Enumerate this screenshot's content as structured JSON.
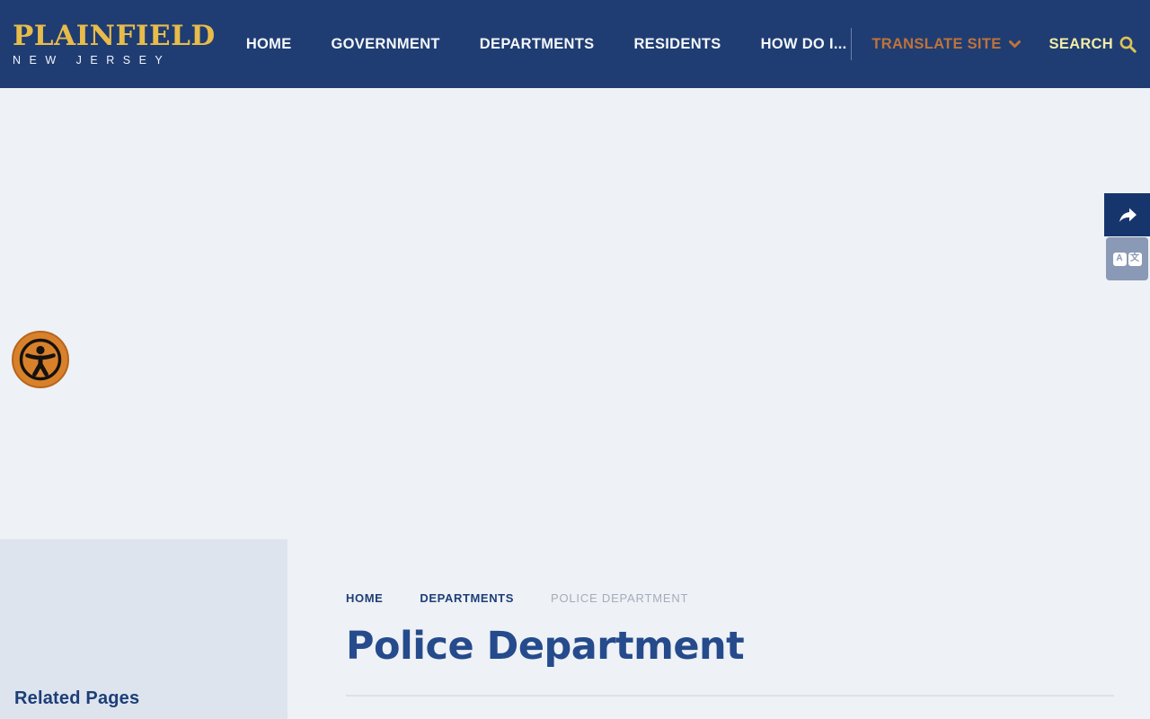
{
  "brand": {
    "name": "PLAINFIELD",
    "tagline": "NEW JERSEY"
  },
  "nav": {
    "items": [
      "HOME",
      "GOVERNMENT",
      "DEPARTMENTS",
      "RESIDENTS",
      "HOW DO I..."
    ],
    "translate": {
      "label": "TRANSLATE SITE",
      "icon": "chevron-down-icon"
    },
    "search": {
      "label": "SEARCH",
      "icon": "search-icon"
    }
  },
  "floating_tools": {
    "share": {
      "icon": "share-arrow-icon"
    },
    "translate": {
      "icon": "translate-icon",
      "letters": {
        "left": "A",
        "right": "文"
      }
    }
  },
  "accessibility": {
    "icon": "universal-access-icon"
  },
  "breadcrumb": {
    "items": [
      "HOME",
      "DEPARTMENTS",
      "POLICE DEPARTMENT"
    ]
  },
  "page": {
    "title": "Police Department"
  },
  "sidebar": {
    "title": "Related Pages"
  },
  "colors": {
    "header-bg": "#1f3d73",
    "gold": "#e8bc4a",
    "orange": "#c0733a",
    "search-text": "#f2eca5",
    "search-icon": "#ddc356",
    "nav-text": "#f5f7fa",
    "page-bg": "#eef1f5",
    "sidebar-bg": "#dde4ed",
    "navy-text": "#1d3e78",
    "heading": "#254b8c",
    "breadcrumb-muted": "#a3adba",
    "share-bg": "#16356d",
    "translate-btn-bg": "#8a99b5",
    "access-orange": "#d9812a",
    "divider": "#dde1e8",
    "nav-divider": "#6b80ab"
  }
}
